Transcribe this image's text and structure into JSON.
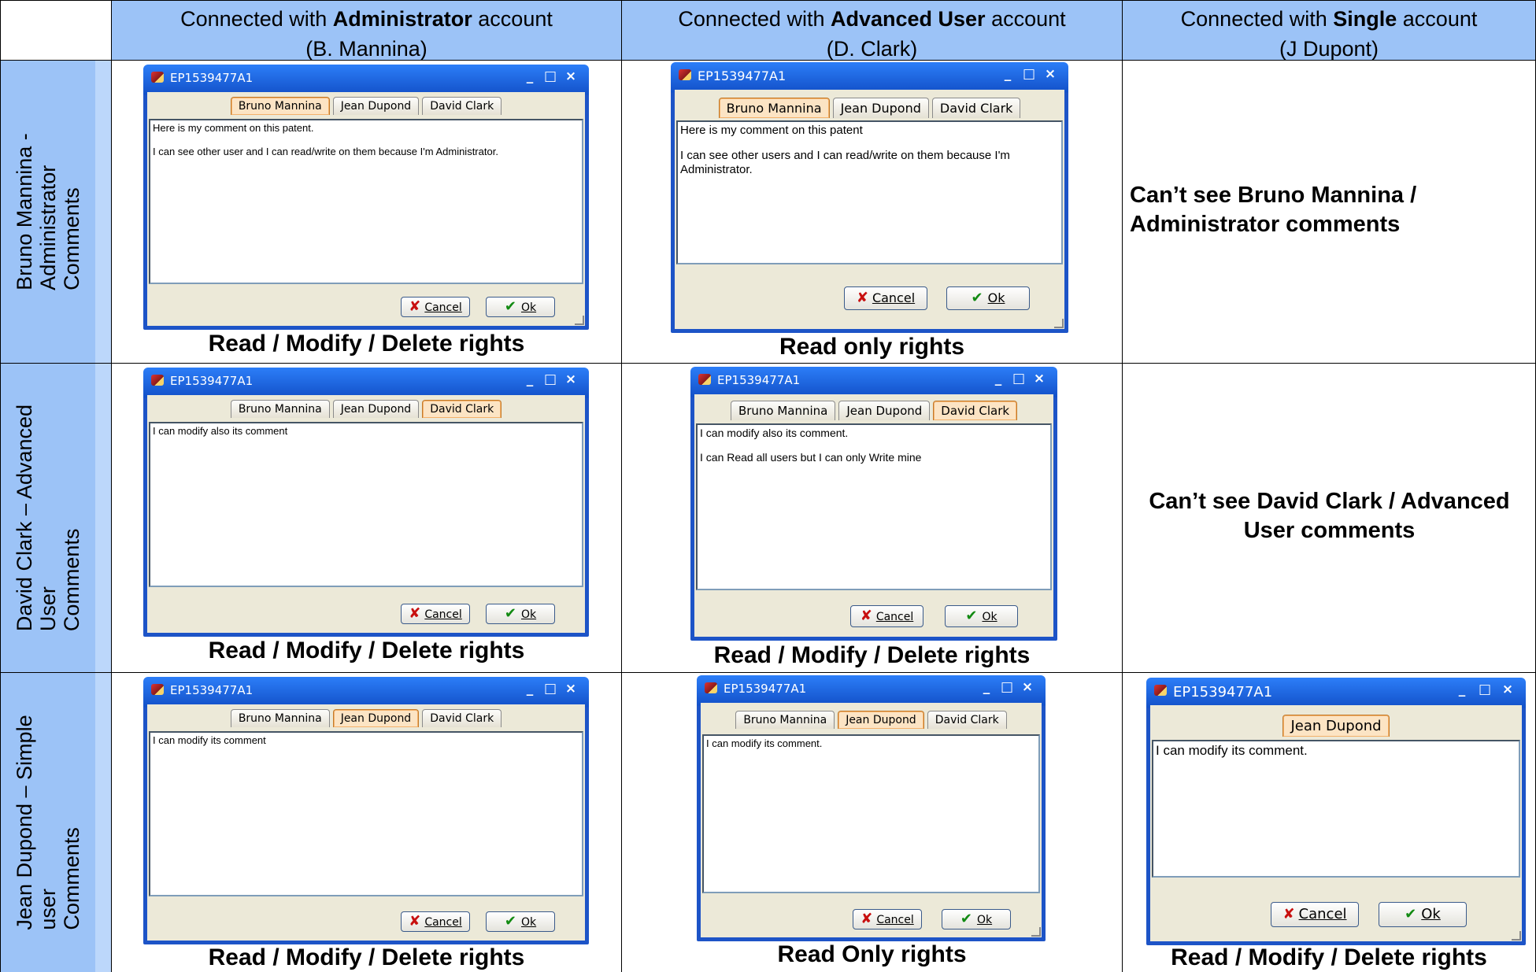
{
  "header": {
    "col1": {
      "prefix": "Connected with ",
      "role": "Administrator",
      "suffix": " account",
      "name": "(B. Mannina)"
    },
    "col2": {
      "prefix": "Connected with ",
      "role": "Advanced User",
      "suffix": " account",
      "name": "(D. Clark)"
    },
    "col3": {
      "prefix": "Connected with ",
      "role": "Single",
      "suffix": " account",
      "name": "(J Dupont)"
    }
  },
  "rows": [
    {
      "label_line1": "Bruno Mannina -",
      "label_line2": "Administrator",
      "label_line3": "Comments"
    },
    {
      "label_line1": "David Clark – Advanced",
      "label_line2": "User",
      "label_line3": "Comments"
    },
    {
      "label_line1": "Jean Dupond – Simple",
      "label_line2": "user",
      "label_line3": "Comments"
    }
  ],
  "dialog": {
    "title": "EP1539477A1",
    "tab_bruno": "Bruno Mannina",
    "tab_jean": "Jean Dupond",
    "tab_david": "David Clark",
    "cancel_label": "Cancel",
    "ok_label": "Ok",
    "minimize": "_",
    "maximize": "□",
    "close": "×"
  },
  "cells": {
    "r1c1": {
      "line1": "Here is my comment on this patent.",
      "line2": "I can see other user and I can read/write on them because I'm Administrator.",
      "caption": "Read / Modify / Delete rights"
    },
    "r1c2": {
      "line1": "Here is my comment on this patent",
      "line2": "I can see other users and I can read/write on them because I'm Administrator.",
      "caption": "Read only rights"
    },
    "r1c3": {
      "message_line1": "Can’t see Bruno Mannina /",
      "message_line2": "Administrator comments"
    },
    "r2c1": {
      "line1": "I can modify also its comment",
      "caption": "Read / Modify / Delete rights"
    },
    "r2c2": {
      "line1": "I can modify also its comment.",
      "line2": "I can Read all users but I can only Write mine",
      "caption": "Read / Modify / Delete rights"
    },
    "r2c3": {
      "message_line1": "Can’t see David Clark / Advanced",
      "message_line2": "User comments"
    },
    "r3c1": {
      "line1": "I can modify its comment",
      "caption": "Read / Modify / Delete rights"
    },
    "r3c2": {
      "line1": "I can modify its comment.",
      "caption": "Read Only rights"
    },
    "r3c3": {
      "line1": "I can modify its comment.",
      "caption": "Read / Modify / Delete rights"
    }
  }
}
